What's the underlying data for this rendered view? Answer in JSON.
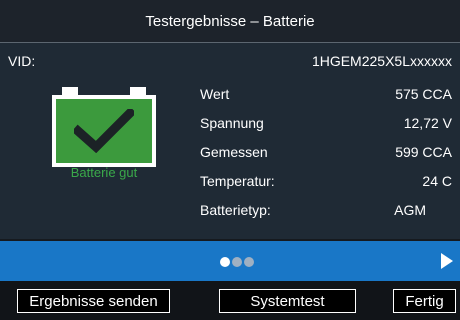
{
  "header": {
    "title": "Testergebnisse – Batterie"
  },
  "vid": {
    "label": "VID:",
    "value": "1HGEM225X5Lxxxxxx"
  },
  "battery": {
    "status_text": "Batterie gut",
    "status_color": "#3aa94a",
    "icon": "battery-ok-check-icon"
  },
  "results": [
    {
      "label": "Wert",
      "value": "575 CCA"
    },
    {
      "label": "Spannung",
      "value": "12,72 V"
    },
    {
      "label": "Gemessen",
      "value": "599 CCA"
    },
    {
      "label": "Temperatur:",
      "value": "24 C"
    },
    {
      "label": "Batterietyp:",
      "value": "AGM"
    }
  ],
  "pager": {
    "pages": 3,
    "active_page": 1,
    "next_icon": "arrow-right-icon"
  },
  "footer": {
    "send_label": "Ergebnisse senden",
    "system_test_label": "Systemtest",
    "done_label": "Fertig"
  },
  "colors": {
    "accent": "#1977c7",
    "battery_green": "#3c9a3d"
  }
}
